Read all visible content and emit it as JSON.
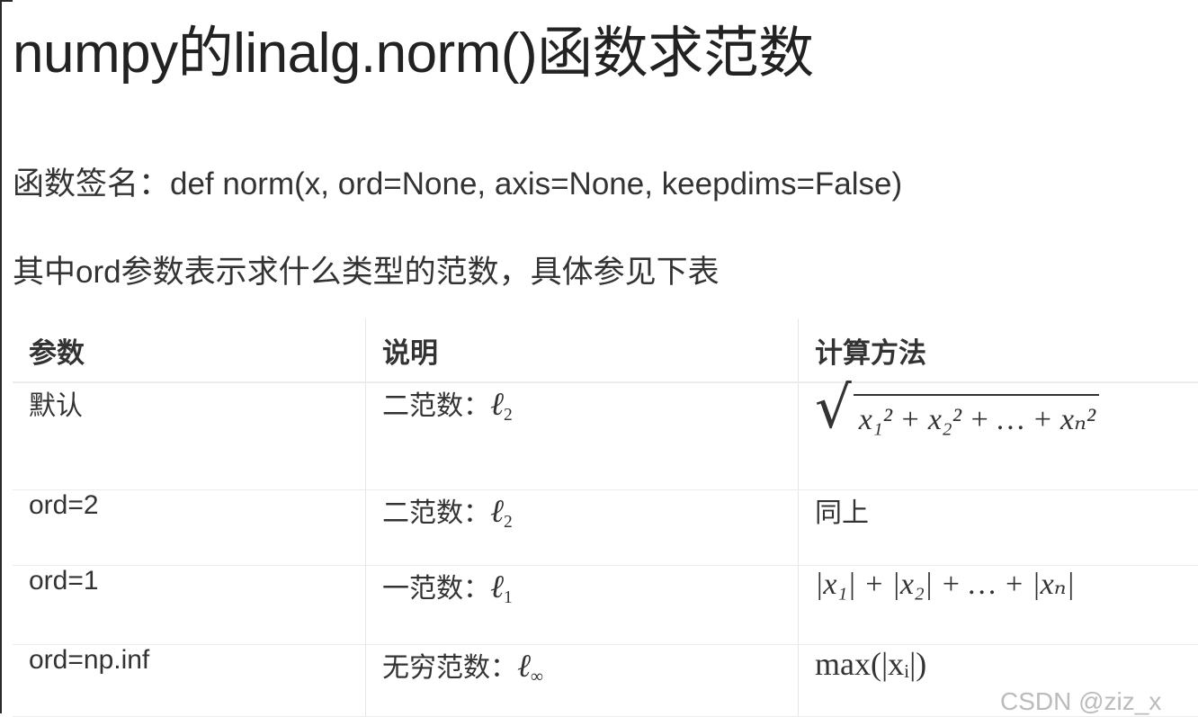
{
  "title": "numpy的linalg.norm()函数求范数",
  "signature": "函数签名：def norm(x, ord=None, axis=None, keepdims=False)",
  "description": "其中ord参数表示求什么类型的范数，具体参见下表",
  "table": {
    "headers": [
      "参数",
      "说明",
      "计算方法"
    ],
    "rows": [
      {
        "param": "默认",
        "desc_prefix": "二范数：",
        "desc_sym": "ℓ",
        "desc_sub": "2",
        "method_type": "sqrt"
      },
      {
        "param": "ord=2",
        "desc_prefix": "二范数：",
        "desc_sym": "ℓ",
        "desc_sub": "2",
        "method_text": "同上"
      },
      {
        "param": "ord=1",
        "desc_prefix": "一范数：",
        "desc_sym": "ℓ",
        "desc_sub": "1",
        "method_type": "abs-sum"
      },
      {
        "param": "ord=np.inf",
        "desc_prefix": "无穷范数：",
        "desc_sym": "ℓ",
        "desc_sub": "∞",
        "method_type": "max"
      }
    ],
    "formulas": {
      "sqrt_terms": [
        "x",
        "x",
        "…",
        "x"
      ],
      "sqrt_text": "x₁² + x₂² + … + xₙ²",
      "abs_sum_text": "|x₁| + |x₂| + … + |xₙ|",
      "max_text": "max(|xᵢ|)"
    }
  },
  "watermark": "CSDN @ziz_x"
}
